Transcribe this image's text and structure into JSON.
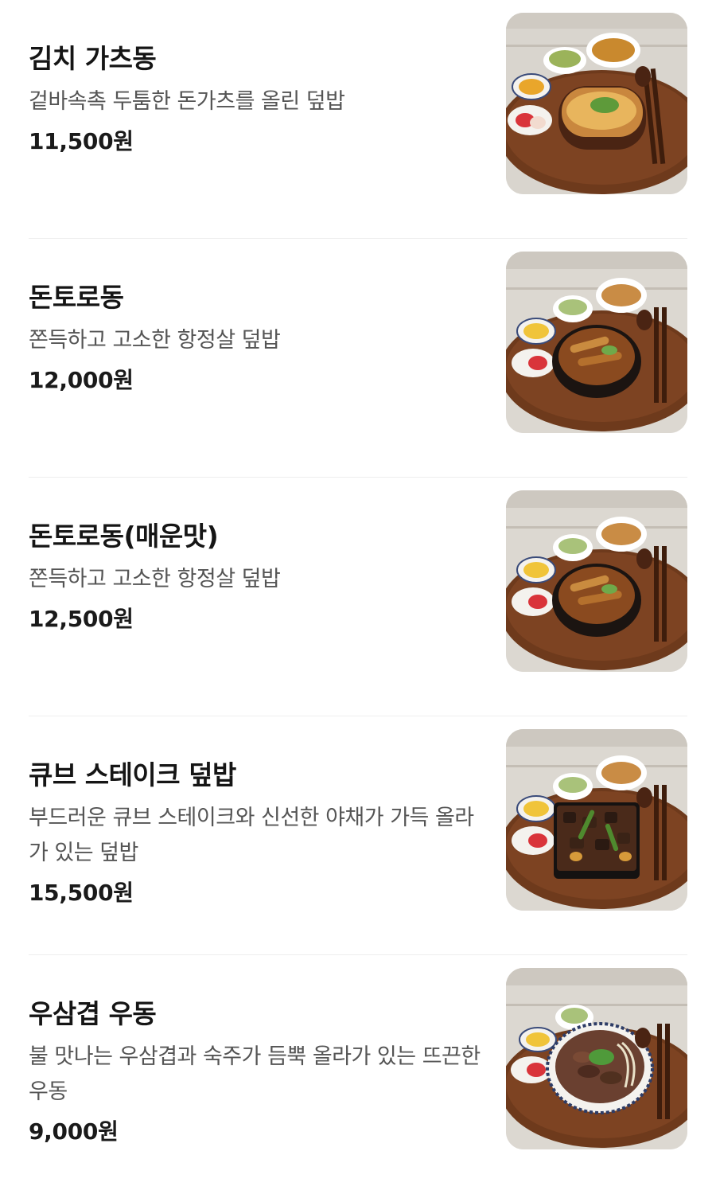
{
  "menu": {
    "items": [
      {
        "name": "김치 가츠동",
        "description": "겉바속촉 두툼한 돈가츠를 올린 덮밥",
        "price": "11,500원",
        "image": "kimchi-katsudon-photo"
      },
      {
        "name": "돈토로동",
        "description": "쫀득하고 고소한 항정살 덮밥",
        "price": "12,000원",
        "image": "tontorodon-photo"
      },
      {
        "name": "돈토로동(매운맛)",
        "description": "쫀득하고 고소한 항정살 덮밥",
        "price": "12,500원",
        "image": "spicy-tontorodon-photo"
      },
      {
        "name": "큐브 스테이크 덮밥",
        "description": "부드러운 큐브 스테이크와 신선한 야채가 가득 올라가 있는 덮밥",
        "price": "15,500원",
        "image": "cube-steak-don-photo"
      },
      {
        "name": "우삼겹 우동",
        "description": "불 맛나는 우삼겹과 숙주가 듬뿍 올라가 있는 뜨끈한 우동",
        "price": "9,000원",
        "image": "beef-brisket-udon-photo"
      }
    ]
  }
}
